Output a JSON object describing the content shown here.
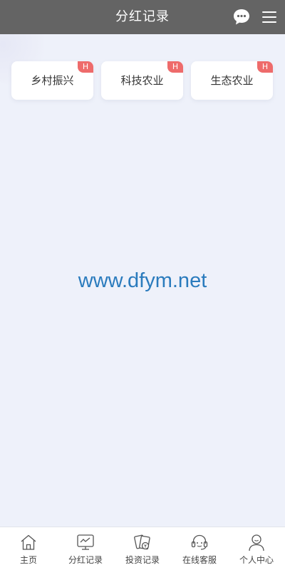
{
  "header": {
    "title": "分红记录",
    "chat_icon": "chat-bubble-icon",
    "menu_icon": "hamburger-menu-icon"
  },
  "categories": [
    {
      "label": "乡村振兴",
      "badge": "H"
    },
    {
      "label": "科技农业",
      "badge": "H"
    },
    {
      "label": "生态农业",
      "badge": "H"
    }
  ],
  "watermark": "www.dfym.net",
  "bottom_nav": [
    {
      "label": "主页",
      "icon": "home-icon"
    },
    {
      "label": "分红记录",
      "icon": "chart-monitor-icon"
    },
    {
      "label": "投资记录",
      "icon": "investment-cards-icon"
    },
    {
      "label": "在线客服",
      "icon": "headset-icon"
    },
    {
      "label": "个人中心",
      "icon": "user-icon"
    }
  ],
  "colors": {
    "header_bg": "#646464",
    "page_bg": "#eef1fa",
    "badge": "#ee6b6b",
    "watermark": "#2a7bbd"
  }
}
